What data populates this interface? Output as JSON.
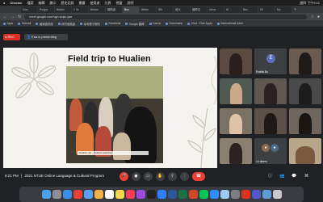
{
  "menubar": {
    "app": "Chrome",
    "items": [
      "檔案",
      "編輯",
      "顯示",
      "歷史記錄",
      "書籤",
      "使用者",
      "分頁",
      "視窗",
      "說明"
    ],
    "status": "週四 下午9:21"
  },
  "tabs": [
    "Vow",
    "Progra",
    "Britain",
    "1 Ye",
    "Britain",
    "國際處",
    "Bec",
    "Writer",
    "Wh",
    "政大",
    "國際交",
    "Inbox",
    "M",
    "Bec",
    "Mi",
    "Mc"
  ],
  "addressbar": {
    "url": "meet.google.com/vgn-wqkc-jwe"
  },
  "bookmarks": [
    "Apps",
    "Hotmail",
    "國家圖書館",
    "研究發展處",
    "臺灣電子期刊",
    "Facebook",
    "Google 翻譯",
    "Canva",
    "Grammarly",
    "Chat - Free Apply",
    "International Admi"
  ],
  "meet": {
    "rec_label": "REC",
    "presenting_label": "Ena is presenting"
  },
  "slide": {
    "title": "Field trip to Hualien",
    "caption": "Hualien trip - Outdoor activities"
  },
  "participants": [
    {
      "name": "",
      "kind": "video"
    },
    {
      "name": "Estella Bu",
      "kind": "avatar",
      "initial": "E",
      "color": "#5c6bc0"
    },
    {
      "name": "",
      "kind": "video"
    },
    {
      "name": "",
      "kind": "video"
    },
    {
      "name": "",
      "kind": "video"
    },
    {
      "name": "",
      "kind": "video"
    },
    {
      "name": "",
      "kind": "video"
    },
    {
      "name": "",
      "kind": "video"
    },
    {
      "name": "",
      "kind": "video"
    },
    {
      "name": "",
      "kind": "video"
    },
    {
      "name": "14 others",
      "kind": "others"
    },
    {
      "name": "",
      "kind": "video"
    }
  ],
  "bottombar": {
    "time": "9:21 PM",
    "separator": "|",
    "meeting_title": "2021 NTUE Online Language & Cultural Program"
  },
  "colors": {
    "end_call": "#ea4335",
    "rec": "#d93025",
    "meet_bg": "#202124"
  }
}
